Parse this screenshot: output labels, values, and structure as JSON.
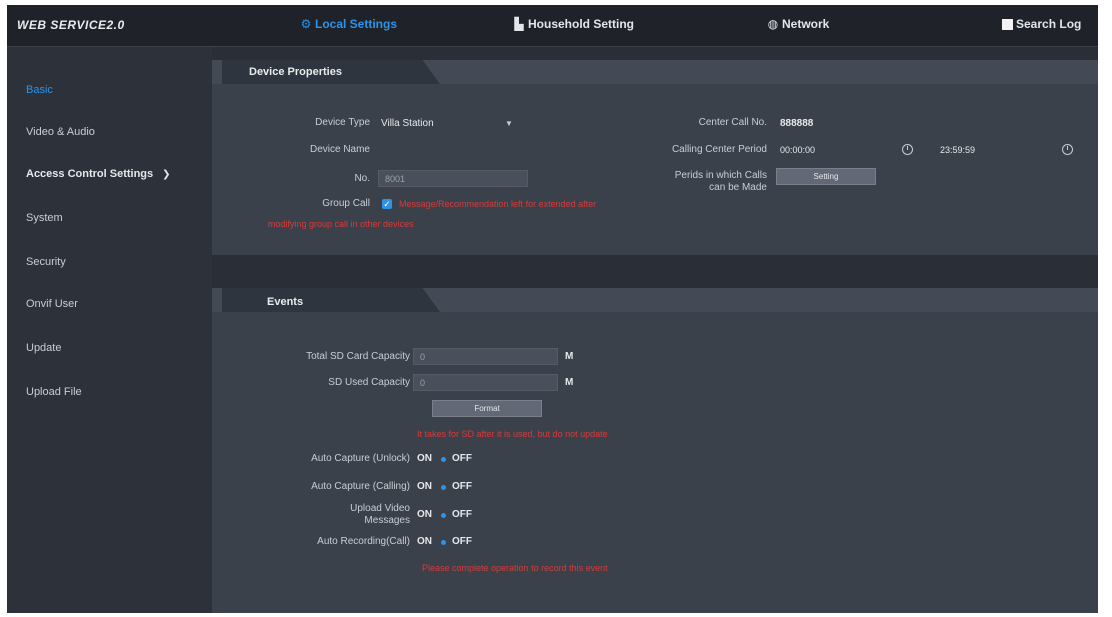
{
  "header": {
    "logo": "WEB SERVICE2.0",
    "tabs": [
      {
        "label": "Local Settings",
        "icon": "gear-icon",
        "active": true
      },
      {
        "label": "Household Setting",
        "icon": "building-icon",
        "active": false
      },
      {
        "label": "Network",
        "icon": "globe-icon",
        "active": false
      },
      {
        "label": "Search Log",
        "icon": "document-icon",
        "active": false
      }
    ]
  },
  "sidebar": {
    "items": [
      {
        "label": "Basic",
        "active": true
      },
      {
        "label": "Video & Audio"
      },
      {
        "label": "Access Control Settings"
      },
      {
        "label": "System"
      },
      {
        "label": "Security"
      },
      {
        "label": "Onvif User"
      },
      {
        "label": "Update"
      },
      {
        "label": "Upload File"
      }
    ]
  },
  "device": {
    "title": "Device Properties",
    "type_label": "Device Type",
    "type_value": "Villa Station",
    "name_label": "Device Name",
    "no_label": "No.",
    "no_value": "8001",
    "group_call_label": "Group Call",
    "group_call_warning_1": "Message/Recommendation left for extended after",
    "group_call_warning_2": "modifying group call in other devices",
    "center_call_label": "Center Call No.",
    "center_call_value": "888888",
    "calling_period_label": "Calling Center Period",
    "period_start": "00:00:00",
    "period_end": "23:59:59",
    "perids_label_1": "Perids in which Calls",
    "perids_label_2": "can be Made",
    "setting_button": "Setting"
  },
  "events": {
    "title": "Events",
    "total_sd_label": "Total SD Card Capacity",
    "total_sd_value": "0",
    "used_sd_label": "SD Used Capacity",
    "used_sd_value": "0",
    "unit": "M",
    "format_button": "Format",
    "format_warning": "It takes for SD after it is used, but do not update",
    "rows": [
      {
        "label": "Auto Capture (Unlock)",
        "on": "ON",
        "off": "OFF"
      },
      {
        "label": "Auto Capture (Calling)",
        "on": "ON",
        "off": "OFF"
      },
      {
        "label_1": "Upload Video",
        "label_2": "Messages",
        "on": "ON",
        "off": "OFF"
      },
      {
        "label": "Auto Recording(Call)",
        "on": "ON",
        "off": "OFF"
      }
    ],
    "recording_warning": "Please complete operation to record this event"
  },
  "colors": {
    "accent": "#2e92e6",
    "warning": "#d63a3a",
    "background": "#2a2f37"
  }
}
